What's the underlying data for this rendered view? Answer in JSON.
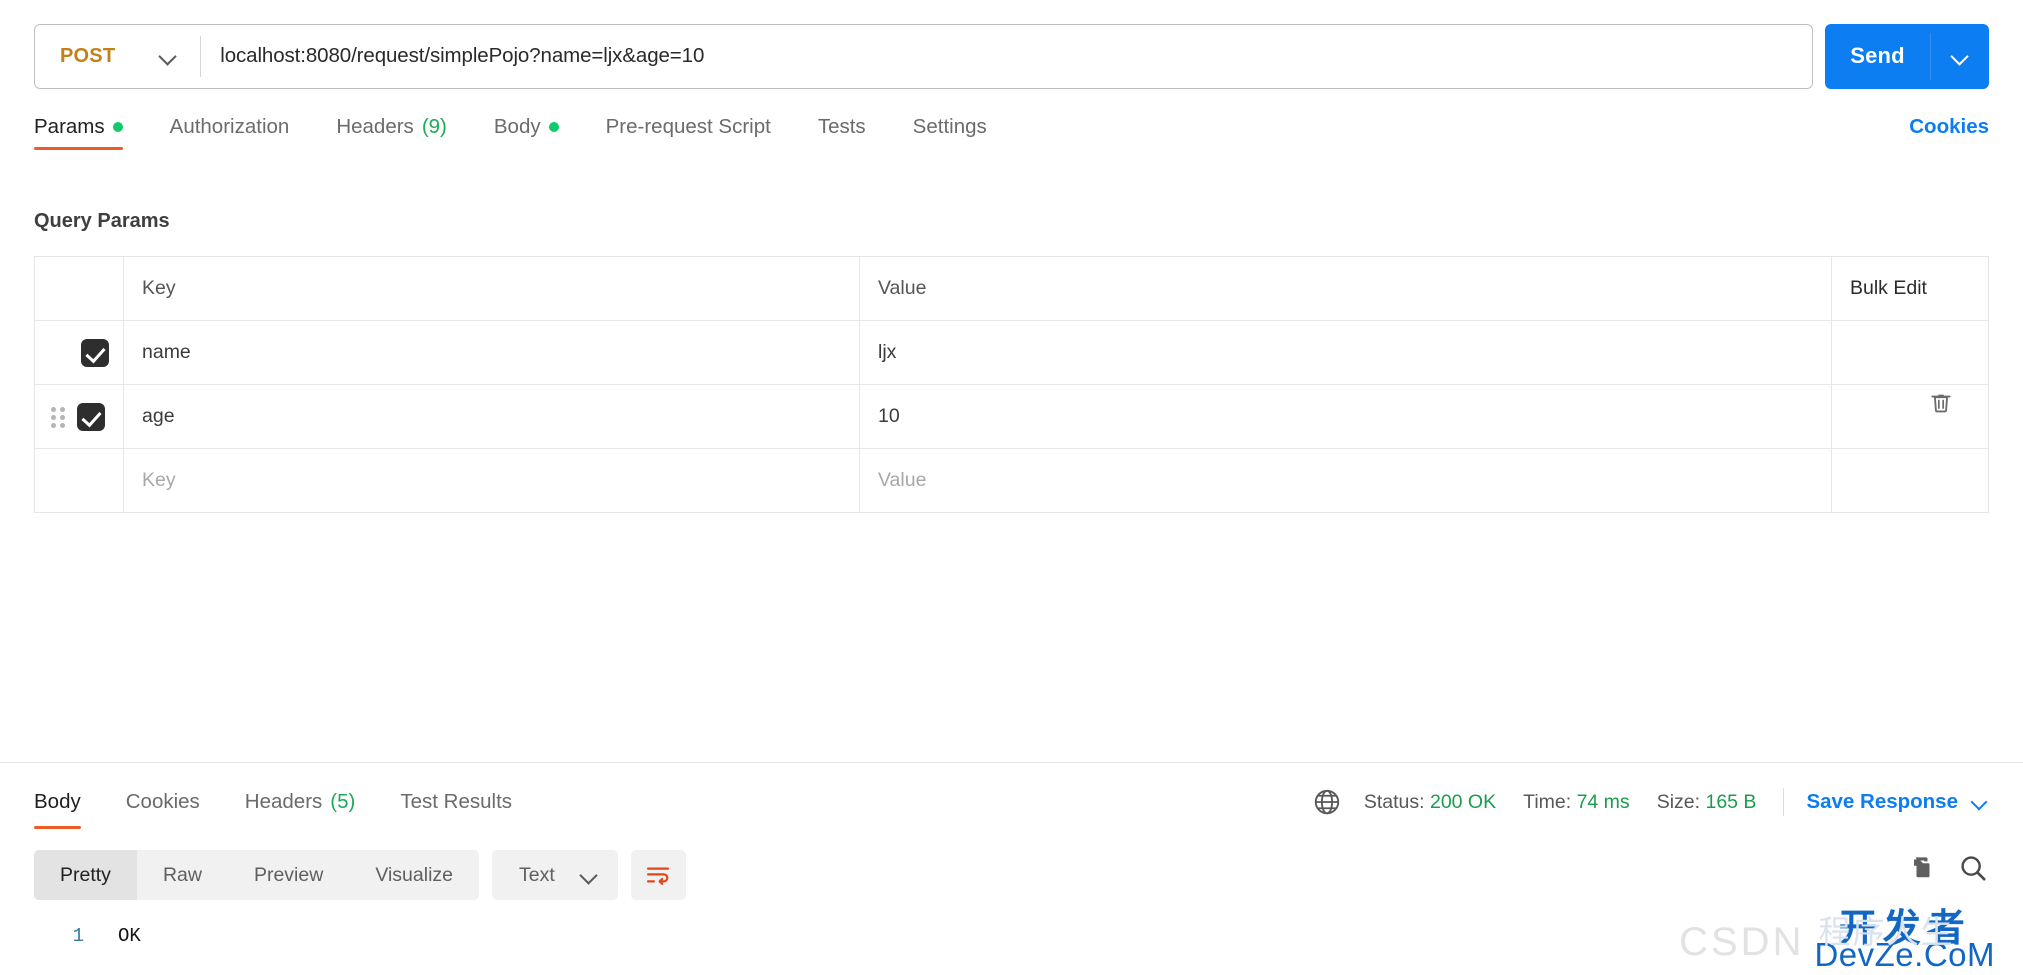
{
  "request": {
    "method": "POST",
    "url": "localhost:8080/request/simplePojo?name=ljx&age=10",
    "send_label": "Send"
  },
  "request_tabs": [
    {
      "label": "Params",
      "dot": true,
      "active": true
    },
    {
      "label": "Authorization",
      "dot": false,
      "active": false
    },
    {
      "label": "Headers",
      "count": "(9)",
      "active": false
    },
    {
      "label": "Body",
      "dot": true,
      "active": false
    },
    {
      "label": "Pre-request Script",
      "active": false
    },
    {
      "label": "Tests",
      "active": false
    },
    {
      "label": "Settings",
      "active": false
    }
  ],
  "cookies_link": "Cookies",
  "query_params": {
    "title": "Query Params",
    "headers": {
      "key": "Key",
      "value": "Value",
      "bulk_edit": "Bulk Edit"
    },
    "rows": [
      {
        "checked": true,
        "key": "name",
        "value": "ljx",
        "draggable": false,
        "deletable": false
      },
      {
        "checked": true,
        "key": "age",
        "value": "10",
        "draggable": true,
        "deletable": true
      }
    ],
    "empty_row": {
      "key_placeholder": "Key",
      "value_placeholder": "Value"
    }
  },
  "response_tabs": [
    {
      "label": "Body",
      "active": true
    },
    {
      "label": "Cookies",
      "active": false
    },
    {
      "label": "Headers",
      "count": "(5)",
      "active": false
    },
    {
      "label": "Test Results",
      "active": false
    }
  ],
  "response_meta": {
    "status_label": "Status:",
    "status_value": "200 OK",
    "time_label": "Time:",
    "time_value": "74 ms",
    "size_label": "Size:",
    "size_value": "165 B",
    "save_response": "Save Response"
  },
  "body_toolbar": {
    "views": [
      "Pretty",
      "Raw",
      "Preview",
      "Visualize"
    ],
    "active_view": "Pretty",
    "format": "Text"
  },
  "response_body": {
    "lines": [
      {
        "number": "1",
        "text": "OK"
      }
    ]
  },
  "watermark": {
    "csdn": "CSDN",
    "cn": "开发者",
    "en": "DevZe.CoM",
    "ghost": "程序人生"
  },
  "colors": {
    "accent_orange": "#ef5b25",
    "brand_blue": "#0c7ef2",
    "method_post": "#c1821a",
    "status_green": "#1a9d4b",
    "dot_green": "#10c96b"
  }
}
